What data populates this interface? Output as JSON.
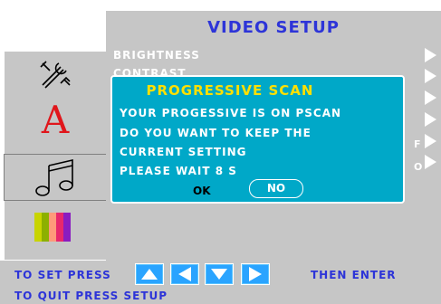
{
  "menu": {
    "title": "VIDEO SETUP",
    "items": [
      {
        "label": "BRIGHTNESS"
      },
      {
        "label": "CONTRAST"
      }
    ],
    "right_letters": [
      "F",
      "O"
    ]
  },
  "sidebar": {
    "icons": [
      "tools-icon",
      "font-a-icon",
      "music-note-icon",
      "color-bars-icon"
    ],
    "selected": "music-note-icon"
  },
  "dialog": {
    "title": "PROGRESSIVE SCAN",
    "lines": [
      "YOUR PROGESSIVE IS ON  PSCAN",
      "DO YOU WANT TO KEEP THE",
      "CURRENT SETTING",
      "PLEASE WAIT 8 S"
    ],
    "ok_label": "OK",
    "no_label": "NO"
  },
  "footer": {
    "set_text": "TO SET PRESS",
    "then_text": "THEN ENTER",
    "quit_text": "TO QUIT PRESS SETUP"
  },
  "colors": {
    "title": "#2d34d8",
    "dialog_bg": "#00a8c8",
    "dialog_title": "#ffe000",
    "panel_bg": "#c6c6c6"
  }
}
